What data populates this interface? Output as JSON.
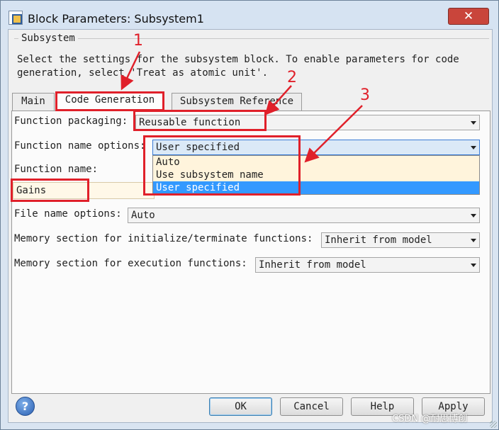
{
  "window": {
    "title": "Block Parameters: Subsystem1",
    "close_label": "✕"
  },
  "group": {
    "label": "Subsystem",
    "description_line1": "Select the settings for the subsystem block. To enable parameters for code",
    "description_line2": "generation, select 'Treat as atomic unit'."
  },
  "tabs": [
    {
      "label": "Main"
    },
    {
      "label": "Code Generation"
    },
    {
      "label": "Subsystem Reference"
    }
  ],
  "fields": {
    "function_packaging": {
      "label": "Function packaging:",
      "value": "Reusable function"
    },
    "function_name_options": {
      "label": "Function name options:",
      "value": "User specified",
      "options": [
        "Auto",
        "Use subsystem name",
        "User specified"
      ]
    },
    "function_name": {
      "label": "Function name:",
      "value": "Gains"
    },
    "file_name_options": {
      "label": "File name options:",
      "value": "Auto"
    },
    "memory_init": {
      "label": "Memory section for initialize/terminate functions:",
      "value": "Inherit from model"
    },
    "memory_exec": {
      "label": "Memory section for execution functions:",
      "value": "Inherit from model"
    }
  },
  "buttons": {
    "ok": "OK",
    "cancel": "Cancel",
    "help": "Help",
    "apply": "Apply"
  },
  "annotations": [
    "1",
    "2",
    "3"
  ],
  "watermark": "CSDN @耐思博创",
  "colors": {
    "annotation_red": "#e0202a",
    "selection_blue": "#3399ff"
  }
}
